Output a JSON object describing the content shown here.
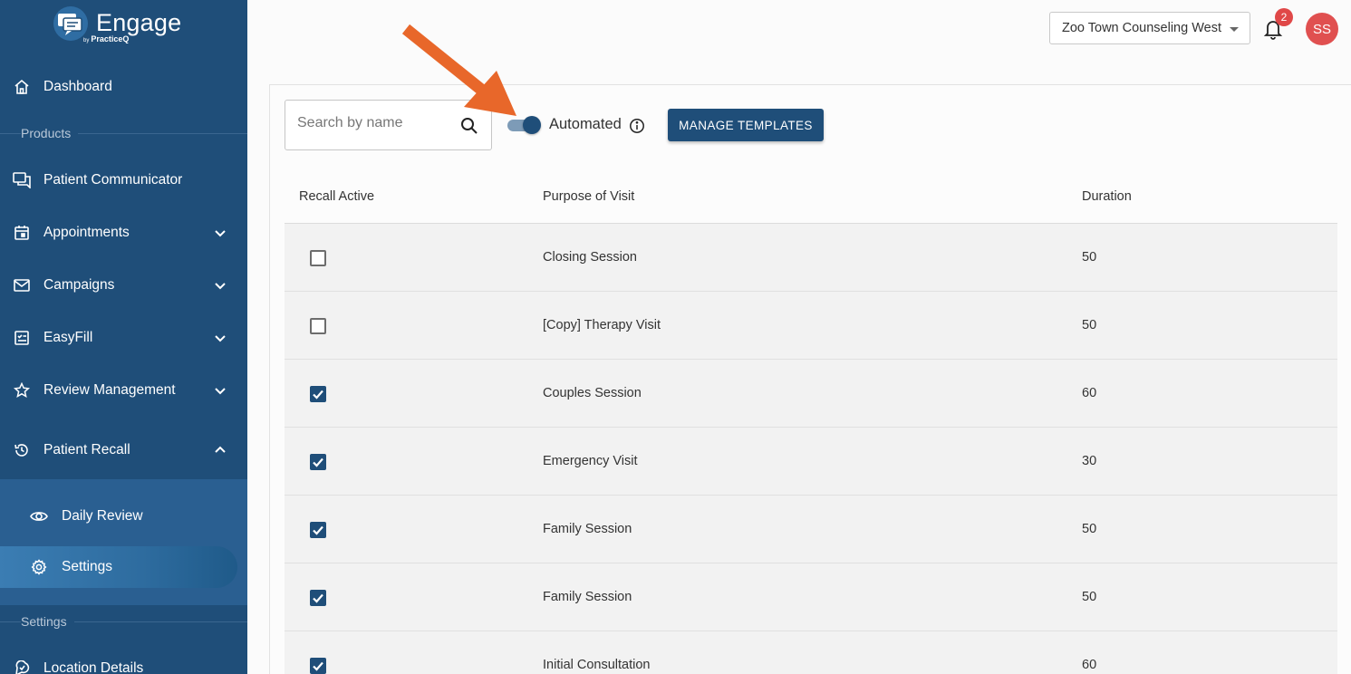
{
  "app": {
    "logo_text": "Engage",
    "logo_by": "by",
    "logo_brand": "PracticeQ"
  },
  "sidebar": {
    "items": [
      {
        "label": "Dashboard",
        "icon": "home-icon"
      },
      {
        "label": "Patient Communicator",
        "icon": "chat-icon"
      },
      {
        "label": "Appointments",
        "icon": "calendar-icon"
      },
      {
        "label": "Campaigns",
        "icon": "mail-icon"
      },
      {
        "label": "EasyFill",
        "icon": "form-icon"
      },
      {
        "label": "Review Management",
        "icon": "star-icon"
      },
      {
        "label": "Patient Recall",
        "icon": "history-icon"
      }
    ],
    "section_products": "Products",
    "section_settings": "Settings",
    "sub_items": [
      {
        "label": "Daily Review",
        "icon": "eye-icon"
      },
      {
        "label": "Settings",
        "icon": "gear-icon"
      }
    ],
    "bottom_item": {
      "label": "Location Details",
      "icon": "pin-icon"
    }
  },
  "header": {
    "location": "Zoo Town Counseling West",
    "notification_count": "2",
    "avatar_initials": "SS"
  },
  "toolbar": {
    "search_placeholder": "Search by name",
    "automated_label": "Automated",
    "automated_on": true,
    "manage_templates": "MANAGE TEMPLATES"
  },
  "table": {
    "headers": {
      "recall_active": "Recall Active",
      "purpose": "Purpose of Visit",
      "duration": "Duration"
    },
    "rows": [
      {
        "active": false,
        "purpose": "Closing Session",
        "duration": "50"
      },
      {
        "active": false,
        "purpose": "[Copy] Therapy Visit",
        "duration": "50"
      },
      {
        "active": true,
        "purpose": "Couples Session",
        "duration": "60"
      },
      {
        "active": true,
        "purpose": "Emergency Visit",
        "duration": "30"
      },
      {
        "active": true,
        "purpose": "Family Session",
        "duration": "50"
      },
      {
        "active": true,
        "purpose": "Family Session",
        "duration": "50"
      },
      {
        "active": true,
        "purpose": "Initial Consultation",
        "duration": "60"
      }
    ]
  },
  "colors": {
    "sidebar": "#1f4e79",
    "primary": "#1f4e79",
    "arrow": "#e8672a",
    "badge": "#e04848"
  }
}
